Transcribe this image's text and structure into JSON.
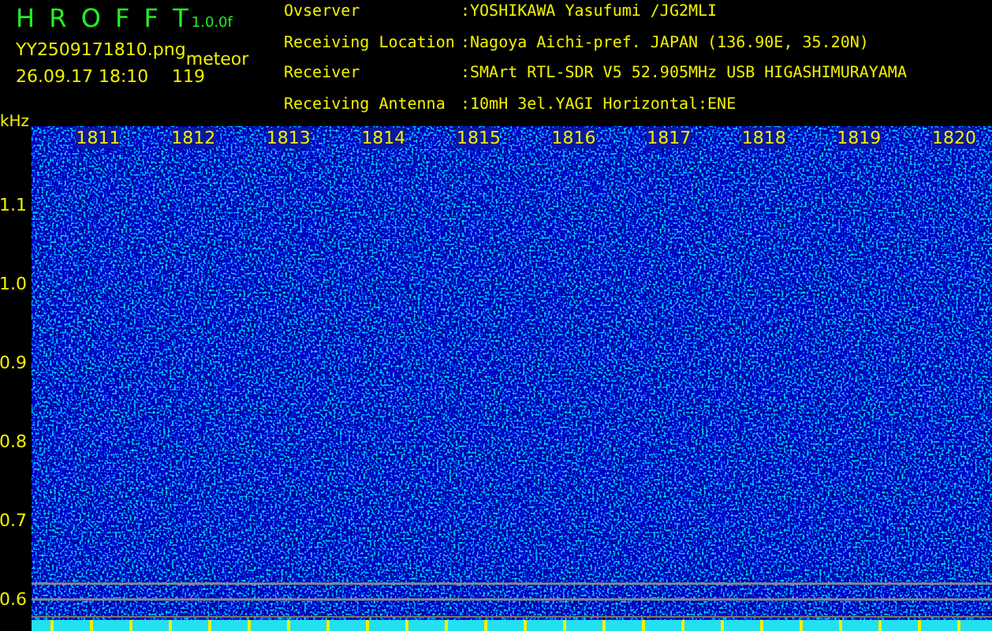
{
  "app": {
    "title": "H R O F F T",
    "version": "1.0.0f",
    "file_name": "YY2509171810.png",
    "timestamp": "26.09.17 18:10",
    "event_type": "meteor",
    "event_count": "119"
  },
  "station_info": [
    {
      "label": "Ovserver",
      "value": ":YOSHIKAWA Yasufumi /JG2MLI"
    },
    {
      "label": "Receiving Location",
      "value": ":Nagoya Aichi-pref. JAPAN (136.90E, 35.20N)"
    },
    {
      "label": "Receiver",
      "value": ":SMArt RTL-SDR V5 52.905MHz USB HIGASHIMURAYAMA"
    },
    {
      "label": "Receiving Antenna",
      "value": ":10mH 3el.YAGI Horizontal:ENE"
    }
  ],
  "spectrogram": {
    "frequency_unit": "kHz",
    "frequency_labels": [
      "1.1",
      "1.0",
      "0.9",
      "0.8",
      "0.7",
      "0.6"
    ],
    "time_labels": [
      "1811",
      "1812",
      "1813",
      "1814",
      "1815",
      "1816",
      "1817",
      "1818",
      "1819",
      "1820"
    ]
  }
}
